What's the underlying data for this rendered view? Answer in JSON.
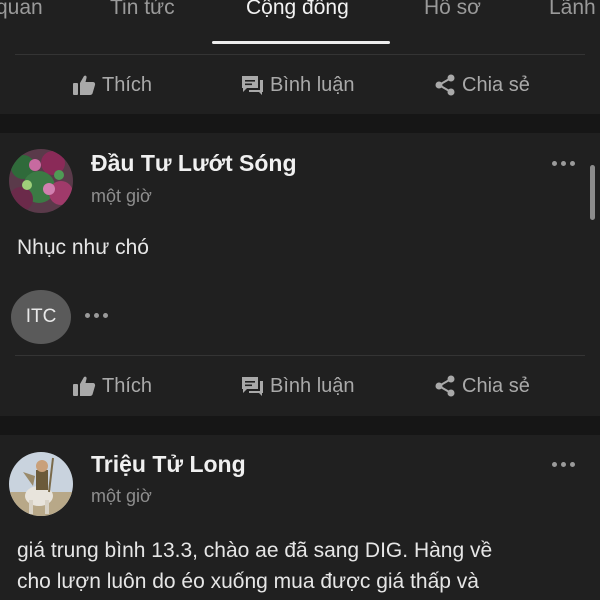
{
  "tabs": [
    {
      "label": "quan",
      "active": false
    },
    {
      "label": "Tin tức",
      "active": false
    },
    {
      "label": "Cộng đồng",
      "active": true
    },
    {
      "label": "Hồ sơ",
      "active": false
    },
    {
      "label": "Lãnh",
      "active": false
    }
  ],
  "actions": {
    "like_label": "Thích",
    "comment_label": "Bình luận",
    "share_label": "Chia sẻ"
  },
  "posts": [
    {
      "author": "Đầu Tư Lướt Sóng",
      "time": "một giờ",
      "content": "Nhục như chó",
      "reaction_avatar_text": "ITC"
    },
    {
      "author": "Triệu Tử Long",
      "time": "một giờ",
      "content_lines": [
        "giá trung bình 13.3, chào ae đã sang DIG. Hàng về",
        "cho lượn luôn do éo xuống mua được giá thấp và"
      ]
    }
  ],
  "colors": {
    "background": "#161616",
    "card": "#202020",
    "text": "#e4e4e4",
    "muted": "#8e8e8e"
  }
}
